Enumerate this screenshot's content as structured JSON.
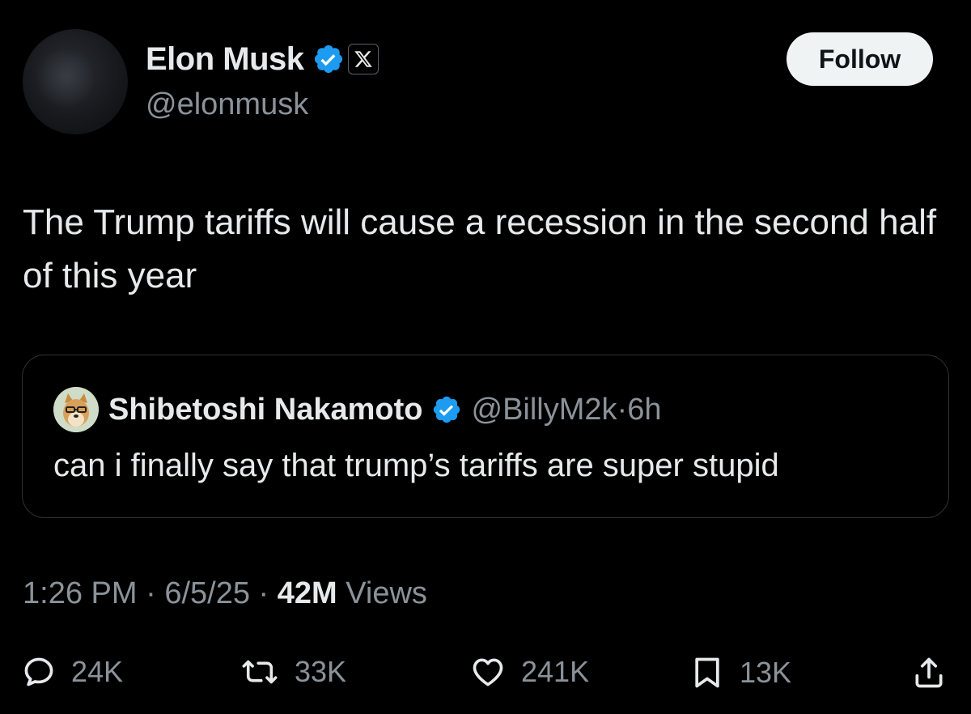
{
  "author": {
    "display_name": "Elon Musk",
    "handle": "@elonmusk",
    "verified_icon": "verified-badge-icon",
    "affiliate_icon": "x-logo-icon"
  },
  "follow_button": {
    "label": "Follow"
  },
  "tweet": {
    "text": "The Trump tariffs will cause a recession in the second half of this year"
  },
  "quoted_tweet": {
    "display_name": "Shibetoshi Nakamoto",
    "handle": "@BillyM2k",
    "time_ago": "6h",
    "separator": "·",
    "text": "can i finally say that trump’s tariffs are super stupid"
  },
  "meta": {
    "time": "1:26 PM",
    "date": "6/5/25",
    "separator": "·",
    "views_count": "42M",
    "views_label": "Views"
  },
  "actions": {
    "replies": "24K",
    "reposts": "33K",
    "likes": "241K",
    "bookmarks": "13K"
  },
  "colors": {
    "background": "#000000",
    "text_primary": "#e7e9ea",
    "text_secondary": "#8b9299",
    "verified_blue": "#1d9bf0",
    "border": "#2f3336"
  }
}
